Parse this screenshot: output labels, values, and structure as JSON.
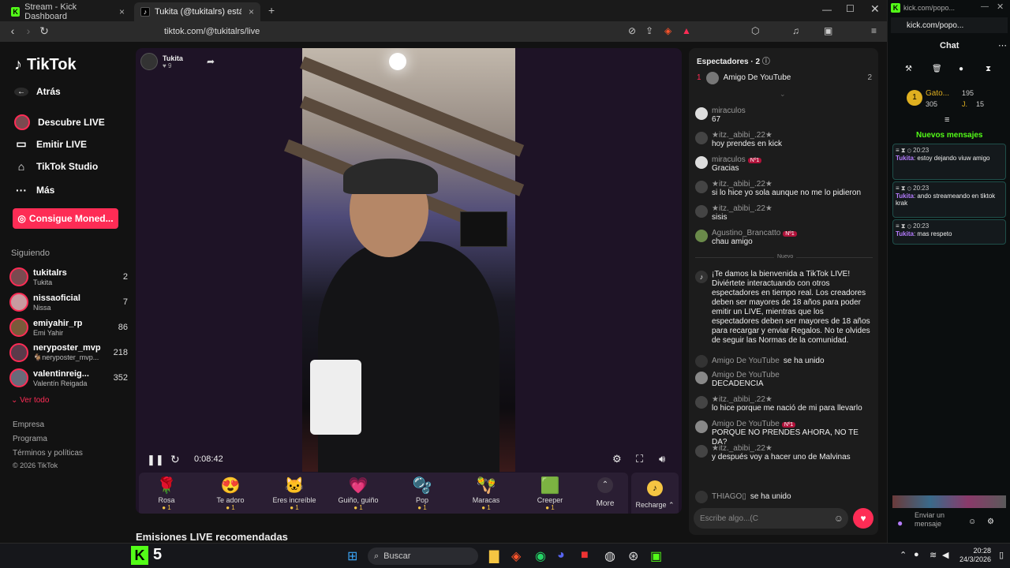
{
  "tabs": [
    {
      "label": "Stream - Kick Dashboard"
    },
    {
      "label": "Tukita (@tukitalrs) está emiti..."
    }
  ],
  "url": "tiktok.com/@tukitalrs/live",
  "sidebar": {
    "logo": "TikTok",
    "nav": [
      {
        "label": "Atrás",
        "icon": "back-arrow-icon"
      },
      {
        "label": "Descubre LIVE",
        "icon": "live-icon"
      },
      {
        "label": "Emitir LIVE",
        "icon": "camera-icon"
      },
      {
        "label": "TikTok Studio",
        "icon": "home-icon"
      },
      {
        "label": "Más",
        "icon": "more-icon"
      }
    ],
    "coins_button": "Consigue Moned...",
    "following_title": "Siguiendo",
    "following": [
      {
        "name": "tukitalrs",
        "sub": "Tukita",
        "count": "2"
      },
      {
        "name": "nissaoficial",
        "sub": "Nissa",
        "count": "7"
      },
      {
        "name": "emiyahir_rp",
        "sub": "Emi Yahir",
        "count": "86"
      },
      {
        "name": "neryposter_mvp",
        "sub": "🐐neryposter_mvp...",
        "count": "218"
      },
      {
        "name": "valentinreig...",
        "sub": "Valentín Reigada",
        "count": "352"
      }
    ],
    "see_all": "Ver todo",
    "footer": [
      "Empresa",
      "Programa",
      "Términos y políticas",
      "© 2026 TikTok"
    ]
  },
  "stream": {
    "host": "Tukita",
    "likes": "9",
    "time": "0:08:42"
  },
  "gifts": [
    {
      "name": "Rosa",
      "icon": "🌹",
      "cost": "1"
    },
    {
      "name": "Te adoro",
      "icon": "😍",
      "cost": "1"
    },
    {
      "name": "Eres increíble",
      "icon": "🐱",
      "cost": "1"
    },
    {
      "name": "Guiño, guiño",
      "icon": "💗",
      "cost": "1"
    },
    {
      "name": "Pop",
      "icon": "🫧",
      "cost": "1"
    },
    {
      "name": "Maracas",
      "icon": "🪇",
      "cost": "1"
    },
    {
      "name": "Creeper",
      "icon": "🟩",
      "cost": "1"
    }
  ],
  "more_label": "More",
  "recharge_label": "Recharge ⌃",
  "recommended": "Emisiones LIVE recomendadas",
  "chat": {
    "viewers_label": "Espectadores · 2",
    "top_viewer": {
      "rank": "1",
      "name": "Amigo De YouTube",
      "count": "2"
    },
    "messages": [
      {
        "name": "miraculos",
        "text": "67",
        "badge": ""
      },
      {
        "name": "★itz._abibi_.22★",
        "text": "hoy prendes en kick",
        "badge": ""
      },
      {
        "name": "miraculos",
        "text": "Gracias",
        "badge": "Nº1"
      },
      {
        "name": "★itz._abibi_.22★",
        "text": "si lo hice yo sola aunque no me lo pidieron",
        "badge": ""
      },
      {
        "name": "★itz._abibi_.22★",
        "text": "sisis",
        "badge": ""
      },
      {
        "name": "Agustino_Brancatto",
        "text": "chau amigo",
        "badge": "Nº1"
      }
    ],
    "new_label": "Nuevo",
    "welcome": "¡Te damos la bienvenida a TikTok LIVE! Diviértete interactuando con otros espectadores en tiempo real. Los creadores deben ser mayores de 18 años para poder emitir un LIVE, mientras que los espectadores deben ser mayores de 18 años para recargar y enviar Regalos. No te olvides de seguir las Normas de la comunidad.",
    "joined1": {
      "name": "Amigo De YouTube",
      "text": "se ha unido"
    },
    "messages2": [
      {
        "name": "Amigo De YouTube",
        "text": "DECADENCIA",
        "badge": ""
      },
      {
        "name": "★itz._abibi_.22★",
        "text": "lo hice porque me nació de mi para llevarlo",
        "badge": ""
      },
      {
        "name": "Amigo De YouTube",
        "text": "PORQUE NO PRENDES AHORA, NO TE DA?",
        "badge": "Nº1"
      },
      {
        "name": "★itz._abibi_.22★",
        "text": "y después voy a hacer uno de Malvinas",
        "badge": ""
      }
    ],
    "joined2": {
      "name": "THIAGO▯",
      "text": "se ha unido"
    },
    "input_placeholder": "Escribe algo...(C"
  },
  "kick": {
    "url": "kick.com/popo...",
    "title": "Chat",
    "user": "Gato...",
    "stats": [
      "195",
      "305",
      "J.",
      "15"
    ],
    "new_messages": "Nuevos mensajes",
    "messages": [
      {
        "time": "20:23",
        "user": "Tukita",
        "text": "estoy dejando viuw amigo"
      },
      {
        "time": "20:23",
        "user": "Tukita",
        "text": "ando streameando en tiktok krak"
      },
      {
        "time": "20:23",
        "user": "Tukita",
        "text": "mas respeto"
      }
    ],
    "send": "Enviar un mensaje"
  },
  "taskbar": {
    "search": "Buscar",
    "time": "20:28",
    "date": "24/3/2026",
    "kick_count": "5"
  }
}
